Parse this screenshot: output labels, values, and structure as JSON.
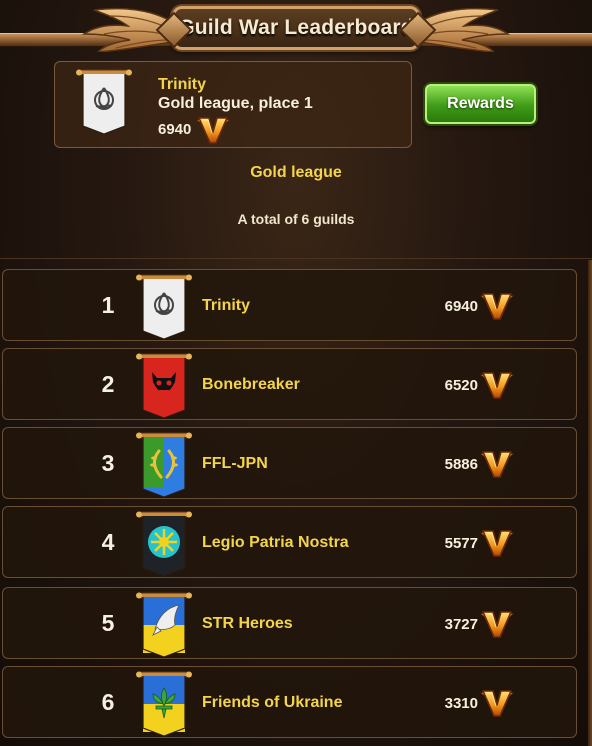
{
  "title": "Guild War Leaderboard",
  "my_guild": {
    "name": "Trinity",
    "league_place": "Gold league, place 1",
    "score": "6940",
    "banner": "white",
    "emblem": "triquetra-icon"
  },
  "rewards_label": "Rewards",
  "league": "Gold league",
  "total": "A total of 6 guilds",
  "score_icon": "v-wings-icon",
  "rows": [
    {
      "rank": "1",
      "name": "Trinity",
      "score": "6940",
      "banner": "white",
      "emblem": "triquetra-icon"
    },
    {
      "rank": "2",
      "name": "Bonebreaker",
      "score": "6520",
      "banner": "red",
      "emblem": "demon-skull-icon"
    },
    {
      "rank": "3",
      "name": "FFL-JPN",
      "score": "5886",
      "banner": "green-blue",
      "emblem": "laurel-wreath-icon"
    },
    {
      "rank": "4",
      "name": "Legio Patria Nostra",
      "score": "5577",
      "banner": "black",
      "emblem": "sun-icon"
    },
    {
      "rank": "5",
      "name": "STR Heroes",
      "score": "3727",
      "banner": "blue-yellow",
      "emblem": "winged-bird-icon"
    },
    {
      "rank": "6",
      "name": "Friends of Ukraine",
      "score": "3310",
      "banner": "blue-yellow",
      "emblem": "fleur-de-lis-icon"
    }
  ],
  "colors": {
    "accent_text": "#f3d44a",
    "rewards_button": "#3f9b18"
  }
}
